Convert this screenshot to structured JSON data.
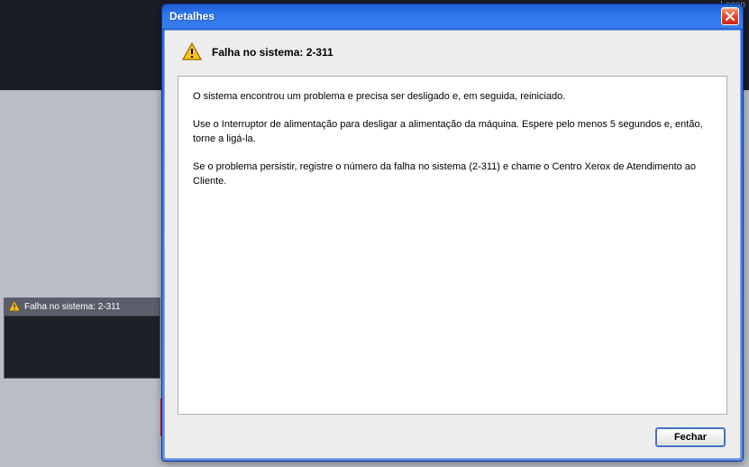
{
  "backgroundStatus": {
    "title": "Falha no sistema: 2-311"
  },
  "topRight": "Logon",
  "dialog": {
    "windowTitle": "Detalhes",
    "headerTitle": "Falha no sistema: 2-311",
    "paragraphs": {
      "p1": "O sistema encontrou um problema e precisa ser desligado e, em seguida, reiniciado.",
      "p2": "Use o Interruptor de alimentação para desligar a alimentação da máquina. Espere pelo menos 5 segundos e, então, torne a ligá-la.",
      "p3": "Se o problema persistir, registre o número da falha no sistema (2-311) e chame o Centro Xerox de Atendimento ao Cliente."
    },
    "closeButton": "Fechar"
  }
}
